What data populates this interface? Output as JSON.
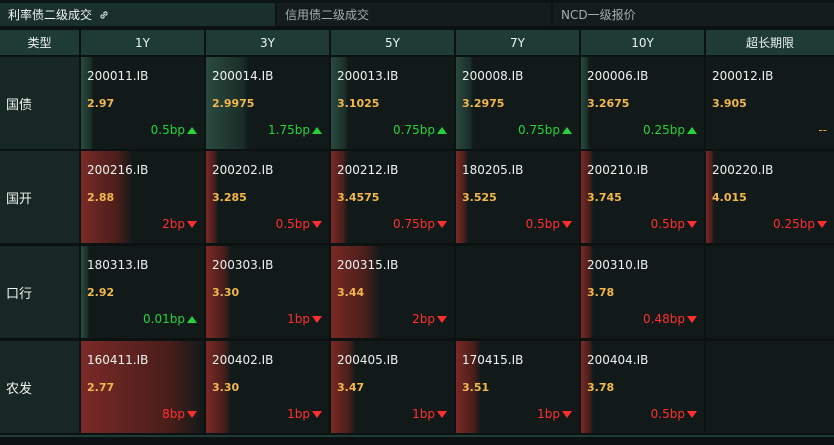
{
  "tabs": [
    {
      "label": "利率债二级成交",
      "active": true
    },
    {
      "label": "信用债二级成交",
      "active": false
    },
    {
      "label": "NCD一级报价",
      "active": false
    }
  ],
  "columns": [
    "类型",
    "1Y",
    "3Y",
    "5Y",
    "7Y",
    "10Y",
    "超长期限"
  ],
  "rows": [
    {
      "type": "国债",
      "cells": [
        {
          "code": "200011.IB",
          "yield": "2.97",
          "change": "0.5bp",
          "dir": "up",
          "level": 0.1
        },
        {
          "code": "200014.IB",
          "yield": "2.9975",
          "change": "1.75bp",
          "dir": "up",
          "level": 0.35
        },
        {
          "code": "200013.IB",
          "yield": "3.1025",
          "change": "0.75bp",
          "dir": "up",
          "level": 0.14
        },
        {
          "code": "200008.IB",
          "yield": "3.2975",
          "change": "0.75bp",
          "dir": "up",
          "level": 0.14
        },
        {
          "code": "200006.IB",
          "yield": "3.2675",
          "change": "0.25bp",
          "dir": "up",
          "level": 0.06
        },
        {
          "code": "200012.IB",
          "yield": "3.905",
          "change": "--",
          "dir": "flat",
          "level": 0
        }
      ]
    },
    {
      "type": "国开",
      "cells": [
        {
          "code": "200216.IB",
          "yield": "2.88",
          "change": "2bp",
          "dir": "down",
          "level": 0.42
        },
        {
          "code": "200202.IB",
          "yield": "3.285",
          "change": "0.5bp",
          "dir": "down",
          "level": 0.1
        },
        {
          "code": "200212.IB",
          "yield": "3.4575",
          "change": "0.75bp",
          "dir": "down",
          "level": 0.14
        },
        {
          "code": "180205.IB",
          "yield": "3.525",
          "change": "0.5bp",
          "dir": "down",
          "level": 0.1
        },
        {
          "code": "200210.IB",
          "yield": "3.745",
          "change": "0.5bp",
          "dir": "down",
          "level": 0.1
        },
        {
          "code": "200220.IB",
          "yield": "4.015",
          "change": "0.25bp",
          "dir": "down",
          "level": 0.06
        }
      ]
    },
    {
      "type": "口行",
      "cells": [
        {
          "code": "180313.IB",
          "yield": "2.92",
          "change": "0.01bp",
          "dir": "up",
          "level": 0
        },
        {
          "code": "200303.IB",
          "yield": "3.30",
          "change": "1bp",
          "dir": "down",
          "level": 0.2
        },
        {
          "code": "200315.IB",
          "yield": "3.44",
          "change": "2bp",
          "dir": "down",
          "level": 0.4
        },
        {
          "code": "",
          "yield": "",
          "change": "",
          "dir": "none",
          "level": 0
        },
        {
          "code": "200310.IB",
          "yield": "3.78",
          "change": "0.48bp",
          "dir": "down",
          "level": 0.1
        },
        {
          "code": "",
          "yield": "",
          "change": "",
          "dir": "none",
          "level": 0
        }
      ]
    },
    {
      "type": "农发",
      "cells": [
        {
          "code": "160411.IB",
          "yield": "2.77",
          "change": "8bp",
          "dir": "down",
          "level": 1.0
        },
        {
          "code": "200402.IB",
          "yield": "3.30",
          "change": "1bp",
          "dir": "down",
          "level": 0.2
        },
        {
          "code": "200405.IB",
          "yield": "3.47",
          "change": "1bp",
          "dir": "down",
          "level": 0.2
        },
        {
          "code": "170415.IB",
          "yield": "3.51",
          "change": "1bp",
          "dir": "down",
          "level": 0.2
        },
        {
          "code": "200404.IB",
          "yield": "3.78",
          "change": "0.5bp",
          "dir": "down",
          "level": 0.1
        },
        {
          "code": "",
          "yield": "",
          "change": "",
          "dir": "none",
          "level": 0
        }
      ]
    }
  ],
  "colors": {
    "up": "#27d13c",
    "down": "#ff2f2f",
    "yield": "#f2b84b",
    "header": "#1e3b35"
  }
}
